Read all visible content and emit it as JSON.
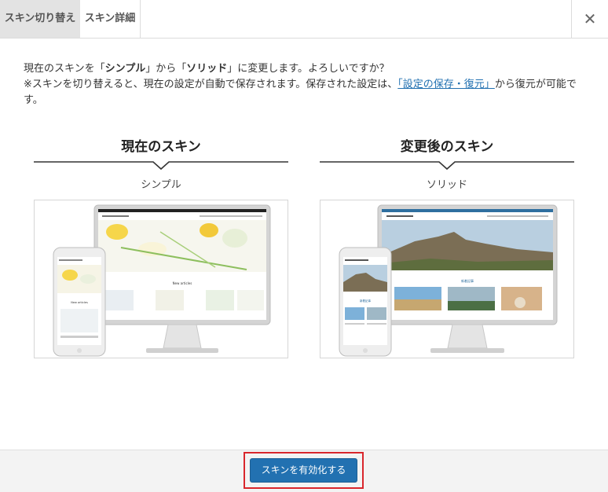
{
  "tabs": [
    {
      "label": "スキン切り替え",
      "active": true
    },
    {
      "label": "スキン詳細",
      "active": false
    }
  ],
  "close_icon": "close-icon",
  "message": {
    "line1_prefix": "現在のスキンを「",
    "current_skin": "シンプル",
    "line1_middle": "」から「",
    "new_skin": "ソリッド",
    "line1_suffix": "」に変更します。よろしいですか？",
    "line2_prefix": "※スキンを切り替えると、現在の設定が自動で保存されます。保存された設定は、",
    "line2_link": "「設定の保存・復元」",
    "line2_suffix": "から復元が可能です。"
  },
  "current": {
    "heading": "現在のスキン",
    "name": "シンプル",
    "preview_site_title": "SAMPLE DEMO SITE",
    "preview_section": "New articles"
  },
  "after": {
    "heading": "変更後のスキン",
    "name": "ソリッド",
    "preview_site_title": "SOLID DEMO SITE",
    "preview_section": "新着記事"
  },
  "footer": {
    "activate_label": "スキンを有効化する"
  },
  "colors": {
    "accent": "#2271b1",
    "highlight_border": "#d9262c"
  }
}
